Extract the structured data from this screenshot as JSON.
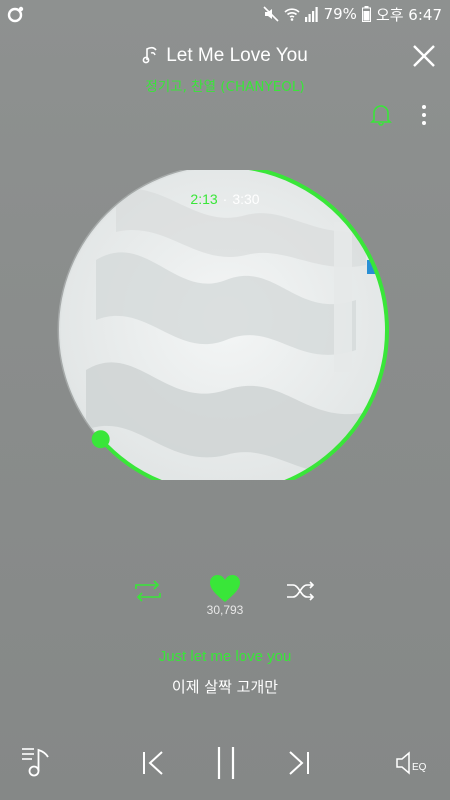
{
  "status_bar": {
    "battery": "79%",
    "time": "오후 6:47"
  },
  "player": {
    "title": "Let Me Love You",
    "artist": "정기고, 찬열 (CHANYEOL)",
    "time_current": "2:13",
    "time_separator": "·",
    "time_total": "3:30",
    "progress": 0.634,
    "like_count": "30,793",
    "lyric_current": "Just let me love you",
    "lyric_next": "이제 살짝 고개만",
    "eq_label": "EQ"
  },
  "colors": {
    "accent": "#39e639",
    "background": "#8b8e8d",
    "text": "#ffffff"
  }
}
